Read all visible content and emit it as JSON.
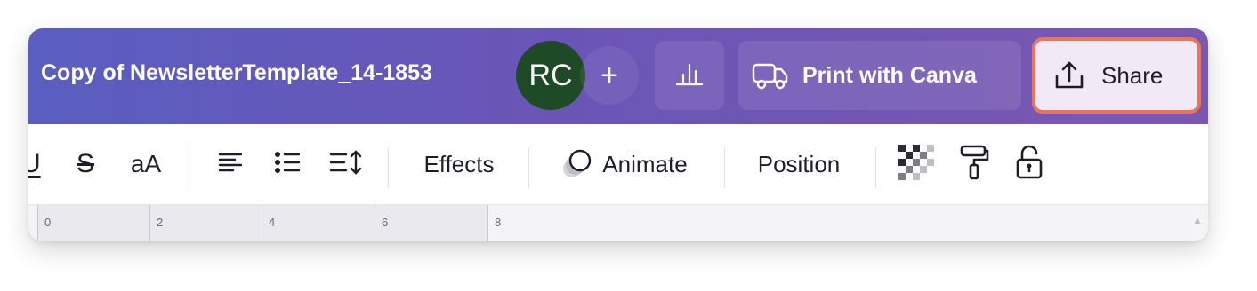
{
  "header": {
    "doc_title": "Copy of NewsletterTemplate_14-1853",
    "avatar_initials": "RC",
    "add_collaborator_glyph": "+",
    "analytics_icon": "bar-chart-icon",
    "print_label": "Print with Canva",
    "print_icon": "truck-icon",
    "share_label": "Share",
    "share_icon": "upload-icon",
    "share_highlight_color": "#e9755a",
    "avatar_color": "#1f4a26"
  },
  "toolbar": {
    "underline_glyph": "U",
    "strikethrough_glyph": "S",
    "letter_case_label": "aA",
    "align_icon": "align-left-icon",
    "list_icon": "bulleted-list-icon",
    "spacing_icon": "line-spacing-icon",
    "effects_label": "Effects",
    "animate_label": "Animate",
    "animate_icon": "animate-icon",
    "position_label": "Position",
    "transparency_icon": "checkerboard-icon",
    "copy_style_icon": "paint-roller-icon",
    "lock_icon": "lock-icon"
  },
  "ruler": {
    "numbers": [
      "0",
      "2",
      "4",
      "6",
      "8"
    ]
  }
}
